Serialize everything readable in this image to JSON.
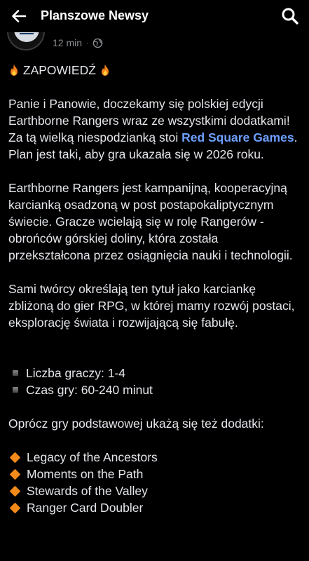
{
  "appbar": {
    "title": "Planszowe Newsy"
  },
  "post": {
    "time": "12 min",
    "separator": "·",
    "avatar_text": "PLANSZOWE NEWSY",
    "heading": "ZAPOWIEDŹ",
    "para1_before": "Panie i Panowie, doczekamy się polskiej edycji Earthborne Rangers wraz ze wszystkimi dodatkami! Za tą wielką niespodzianką stoi ",
    "para1_link": "Red Square Games",
    "para1_after": ". Plan jest taki, aby gra ukazała się w 2026 roku.",
    "para2": "Earthborne Rangers jest kampanijną, kooperacyjną karcianką osadzoną w post postapokaliptycznym świecie. Gracze wcielają się w rolę Rangerów - obrońców górskiej doliny, która została przekształcona przez osiągnięcia nauki i technologii.",
    "para3": "Sami twórcy określają ten tytuł jako karciankę zbliżoną do gier RPG, w której mamy rozwój postaci, eksplorację świata i rozwijającą się fabułę.",
    "facts": [
      "Liczba graczy: 1-4",
      "Czas gry: 60-240 minut"
    ],
    "expansions_intro": "Oprócz gry podstawowej ukażą się też dodatki:",
    "expansions": [
      "Legacy of the Ancestors",
      "Moments on the Path",
      "Stewards of the Valley",
      "Ranger Card Doubler"
    ]
  },
  "colors": {
    "background": "#000000",
    "text": "#e4e6eb",
    "meta": "#8a8d91",
    "link": "#6d9fff",
    "diamond": "#f28a1a"
  },
  "icons": {
    "back": "arrow-left-icon",
    "search": "search-icon",
    "globe": "globe-icon",
    "fire": "fire-emoji",
    "square_bullet": "small-square-bullet",
    "diamond_bullet": "orange-diamond-bullet"
  }
}
